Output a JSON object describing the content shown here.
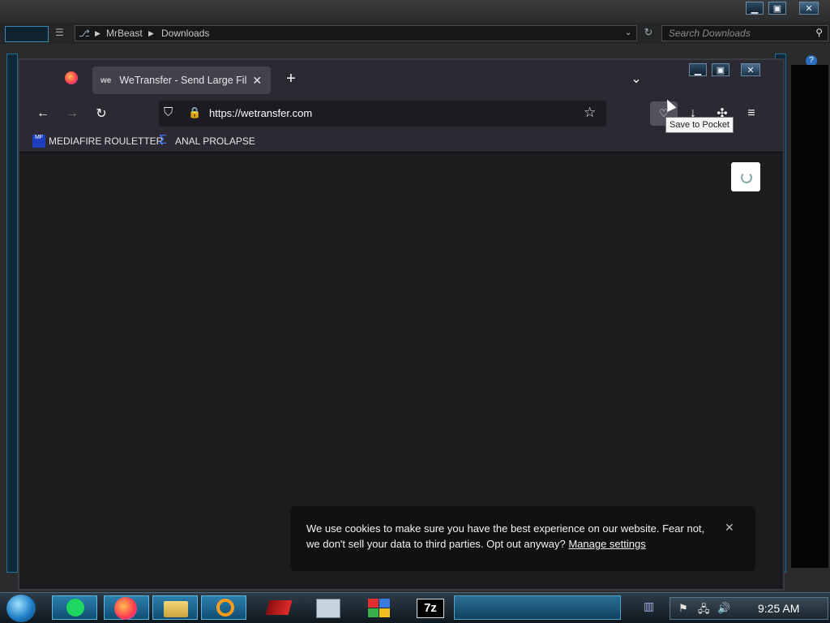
{
  "explorer": {
    "breadcrumb": [
      "MrBeast",
      "Downloads"
    ],
    "search_placeholder": "Search Downloads"
  },
  "firefox": {
    "tab_title": "WeTransfer - Send Large Files &",
    "tab_favicon_text": "we",
    "url": "https://wetransfer.com",
    "tooltip": "Save to Pocket",
    "bookmarks": [
      {
        "label": "MEDIAFIRE ROULETTER",
        "icon_text": "MF"
      },
      {
        "label": "ANAL PROLAPSE"
      }
    ],
    "cookie_banner": {
      "text": "We use cookies to make sure you have the best experience on our website. Fear not, we don't sell your data to third parties. Opt out anyway?",
      "link": "Manage settings"
    }
  },
  "taskbar": {
    "clock": "9:25 AM",
    "apps": [
      "start-orb",
      "spotify",
      "firefox",
      "file-explorer",
      "search",
      "game-app",
      "keyboard-app",
      "control-panel",
      "7zip"
    ],
    "zip_label": "7z"
  },
  "colors": {
    "accent_blue": "#1d9bd1",
    "browser_bg": "#1c1b22",
    "toolbar_bg": "#2b2a33",
    "taskbar_active": "#2c7fae"
  }
}
